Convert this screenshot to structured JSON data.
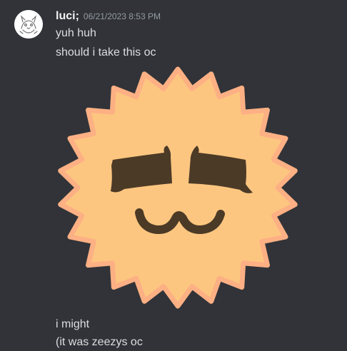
{
  "message": {
    "author": "luci;",
    "timestamp": "06/21/2023 8:53 PM",
    "lines_before": [
      "yuh huh",
      "should i take this oc"
    ],
    "lines_after": [
      "i might",
      "(it was zeezys oc"
    ]
  },
  "colors": {
    "background": "#313338",
    "username": "#f2f3f5",
    "text": "#dbdee1",
    "timestamp": "#949ba4",
    "oc_fill": "#fdc680",
    "oc_outline": "#fcb084",
    "oc_features": "#4b3a26"
  },
  "icons": {
    "avatar": "sketch-avatar-icon"
  }
}
